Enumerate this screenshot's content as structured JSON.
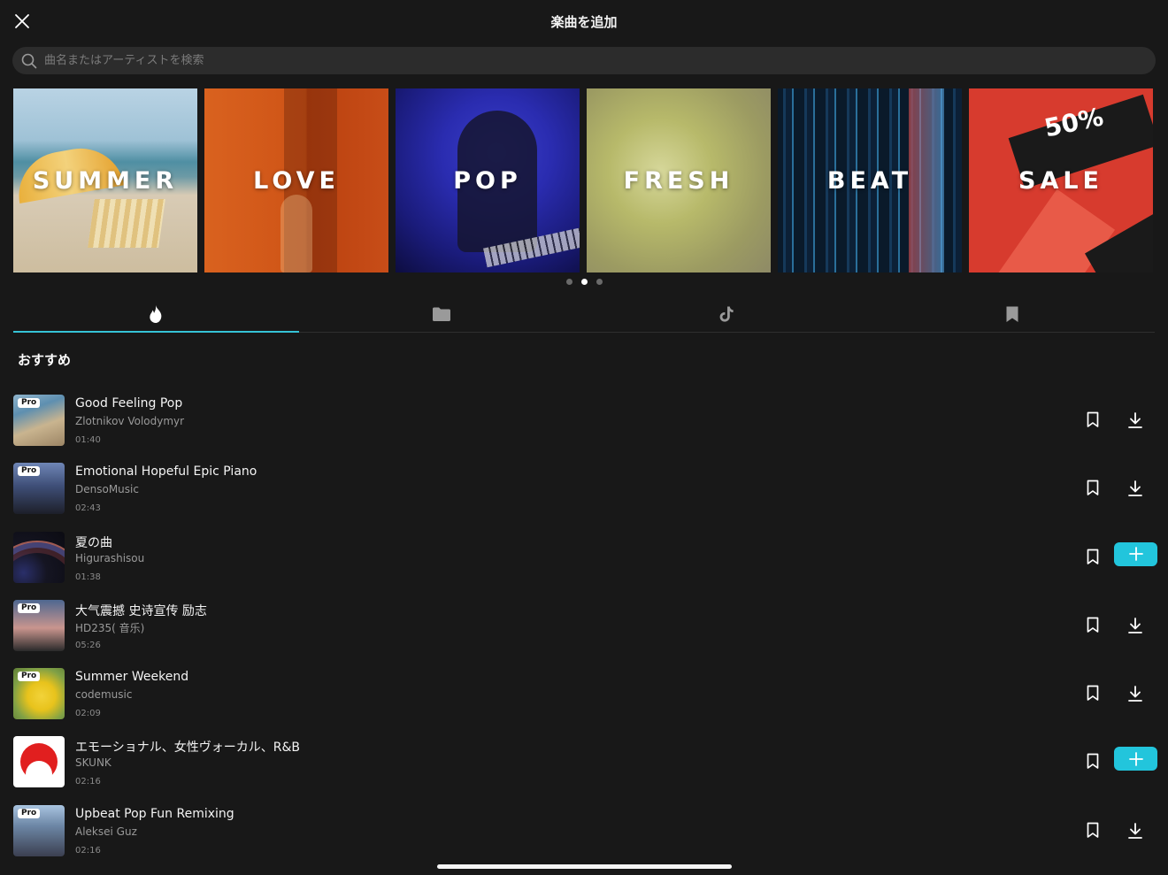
{
  "header": {
    "title": "楽曲を追加"
  },
  "search": {
    "placeholder": "曲名またはアーティストを検索"
  },
  "genres": [
    {
      "label": "SUMMER"
    },
    {
      "label": "LOVE"
    },
    {
      "label": "POP"
    },
    {
      "label": "FRESH"
    },
    {
      "label": "BEAT"
    },
    {
      "label": "SALE",
      "image_text": "50%"
    }
  ],
  "carousel": {
    "pages": 3,
    "active_page": 2
  },
  "tabs": [
    {
      "icon": "flame-icon",
      "active": true
    },
    {
      "icon": "folder-icon",
      "active": false
    },
    {
      "icon": "tiktok-icon",
      "active": false
    },
    {
      "icon": "bookmark-icon",
      "active": false
    }
  ],
  "section": {
    "title": "おすすめ"
  },
  "badge": {
    "pro": "Pro"
  },
  "songs": [
    {
      "title": "Good Feeling Pop",
      "artist": "Zlotnikov Volodymyr",
      "duration": "01:40",
      "pro": true,
      "action": "download"
    },
    {
      "title": "Emotional Hopeful Epic Piano",
      "artist": "DensoMusic",
      "duration": "02:43",
      "pro": true,
      "action": "download"
    },
    {
      "title": "夏の曲",
      "artist": "Higurashisou",
      "duration": "01:38",
      "pro": false,
      "action": "add"
    },
    {
      "title": "大气震撼 史诗宣传 励志",
      "artist": "HD235( 音乐)",
      "duration": "05:26",
      "pro": true,
      "action": "download"
    },
    {
      "title": "Summer Weekend",
      "artist": "codemusic",
      "duration": "02:09",
      "pro": true,
      "action": "download"
    },
    {
      "title": "エモーショナル、女性ヴォーカル、R&B",
      "artist": "SKUNK",
      "duration": "02:16",
      "pro": false,
      "action": "add"
    },
    {
      "title": "Upbeat Pop Fun Remixing",
      "artist": "Aleksei Guz",
      "duration": "02:16",
      "pro": true,
      "action": "download"
    }
  ],
  "colors": {
    "accent": "#22c5dc",
    "background": "#181818"
  }
}
